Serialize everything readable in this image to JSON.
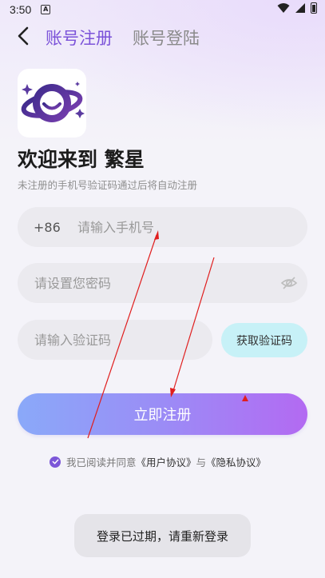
{
  "status_bar": {
    "time": "3:50",
    "notification_glyph": "A"
  },
  "header": {
    "tab_register": "账号注册",
    "tab_login": "账号登陆"
  },
  "welcome": {
    "title": "欢迎来到 繁星",
    "subtitle": "未注册的手机号验证码通过后将自动注册"
  },
  "form": {
    "phone_prefix": "+86",
    "phone_placeholder": "请输入手机号",
    "phone_value": "",
    "password_placeholder": "请设置您密码",
    "password_value": "",
    "code_placeholder": "请输入验证码",
    "code_value": "",
    "get_code_label": "获取验证码",
    "register_label": "立即注册"
  },
  "agreement": {
    "prefix": "我已阅读并同意",
    "user_agreement": "《用户协议》",
    "and": "与",
    "privacy_agreement": "《隐私协议》",
    "checked": true
  },
  "toast": {
    "message": "登录已过期，请重新登录"
  },
  "colors": {
    "accent": "#7b52d9",
    "inactive_tab": "#8a8a8a",
    "get_code_bg": "#c7f1f7",
    "register_gradient_start": "#8aa9f9",
    "register_gradient_end": "#b36af2",
    "annotation_red": "#e01e1e"
  },
  "icons": {
    "back": "chevron-left-icon",
    "eye": "eye-off-icon",
    "check": "check-circle-icon",
    "logo": "planet-smile-logo"
  }
}
